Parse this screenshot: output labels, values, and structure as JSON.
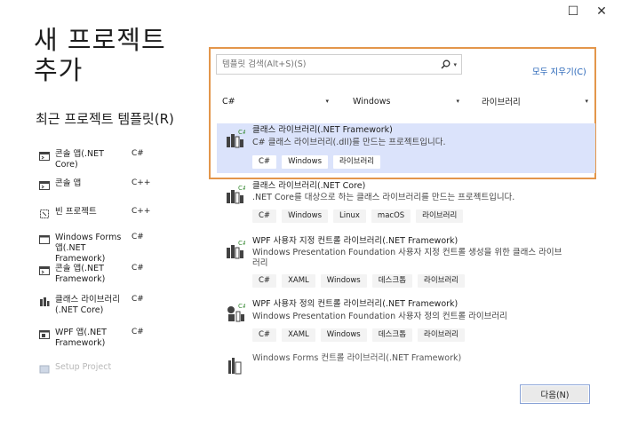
{
  "window": {
    "maximize_glyph": "☐",
    "close_glyph": "✕"
  },
  "page_title": "새 프로젝트 추가",
  "recent": {
    "title": "최근 프로젝트 템플릿(R)",
    "items": [
      {
        "name": "콘솔 앱(.NET Core)",
        "lang": "C#",
        "icon": "console-app-icon"
      },
      {
        "name": "콘솔 앱",
        "lang": "C++",
        "icon": "console-app-icon"
      },
      {
        "name": "빈 프로젝트",
        "lang": "C++",
        "icon": "empty-project-icon"
      },
      {
        "name": "Windows Forms 앱(.NET Framework)",
        "lang": "C#",
        "icon": "windows-forms-icon"
      },
      {
        "name": "콘솔 앱(.NET Framework)",
        "lang": "C#",
        "icon": "console-app-icon"
      },
      {
        "name": "클래스 라이브러리(.NET Core)",
        "lang": "C#",
        "icon": "class-library-icon"
      },
      {
        "name": "WPF 앱(.NET Framework)",
        "lang": "C#",
        "icon": "wpf-app-icon"
      },
      {
        "name": "Setup Project",
        "lang": "",
        "icon": "setup-project-icon"
      }
    ]
  },
  "search": {
    "placeholder": "템플릿 검색(Alt+S)(S)"
  },
  "clear_all": "모두 지우기(C)",
  "filters": {
    "language": "C#",
    "platform": "Windows",
    "project_type": "라이브러리"
  },
  "templates": [
    {
      "name": "클래스 라이브러리(.NET Framework)",
      "desc": "C# 클래스 라이브러리(.dll)를 만드는 프로젝트입니다.",
      "tags": [
        "C#",
        "Windows",
        "라이브러리"
      ]
    },
    {
      "name": "클래스 라이브러리(.NET Core)",
      "desc": ".NET Core를 대상으로 하는 클래스 라이브러리를 만드는 프로젝트입니다.",
      "tags": [
        "C#",
        "Windows",
        "Linux",
        "macOS",
        "라이브러리"
      ]
    },
    {
      "name": "WPF 사용자 지정 컨트롤 라이브러리(.NET Framework)",
      "desc": "Windows Presentation Foundation 사용자 지정 컨트롤 생성을 위한 클래스 라이브러리",
      "tags": [
        "C#",
        "XAML",
        "Windows",
        "데스크톱",
        "라이브러리"
      ]
    },
    {
      "name": "WPF 사용자 정의 컨트롤 라이브러리(.NET Framework)",
      "desc": "Windows Presentation Foundation 사용자 정의 컨트롤 라이브러리",
      "tags": [
        "C#",
        "XAML",
        "Windows",
        "데스크톱",
        "라이브러리"
      ]
    },
    {
      "name": "Windows Forms 컨트롤 라이브러리(.NET Framework)",
      "desc": "",
      "tags": []
    }
  ],
  "next_button": "다음(N)",
  "colors": {
    "highlight_border": "#e3964b",
    "selected_bg": "#dbe3fb",
    "link": "#1f5fb5"
  }
}
